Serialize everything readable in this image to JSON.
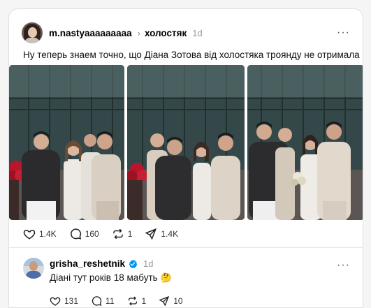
{
  "post": {
    "username": "m.nastyaaaaaaaaa",
    "separator": "›",
    "topic": "холостяк",
    "time": "1d",
    "more": "···",
    "text": "Ну теперь знаем точно, що Діана Зотова від холостяка троянду не отримала",
    "photos": [
      "wedding-group-photo-1",
      "wedding-group-photo-2",
      "wedding-group-photo-3"
    ],
    "actions": {
      "likes": "1.4K",
      "comments": "160",
      "reposts": "1",
      "shares": "1.4K"
    }
  },
  "reply": {
    "username": "grisha_reshetnik",
    "verified_icon": "verified-badge-icon",
    "time": "1d",
    "more": "···",
    "text": "Діані тут років 18 мабуть",
    "emoji": "🤔",
    "actions": {
      "likes": "131",
      "comments": "11",
      "reposts": "1",
      "shares": "10"
    }
  },
  "colors": {
    "background": "#f5f5f5",
    "card": "#ffffff",
    "text": "#111111",
    "muted": "#999999",
    "verified": "#0095f6",
    "building": "#3c4b4d",
    "roses": "#b8162a"
  }
}
